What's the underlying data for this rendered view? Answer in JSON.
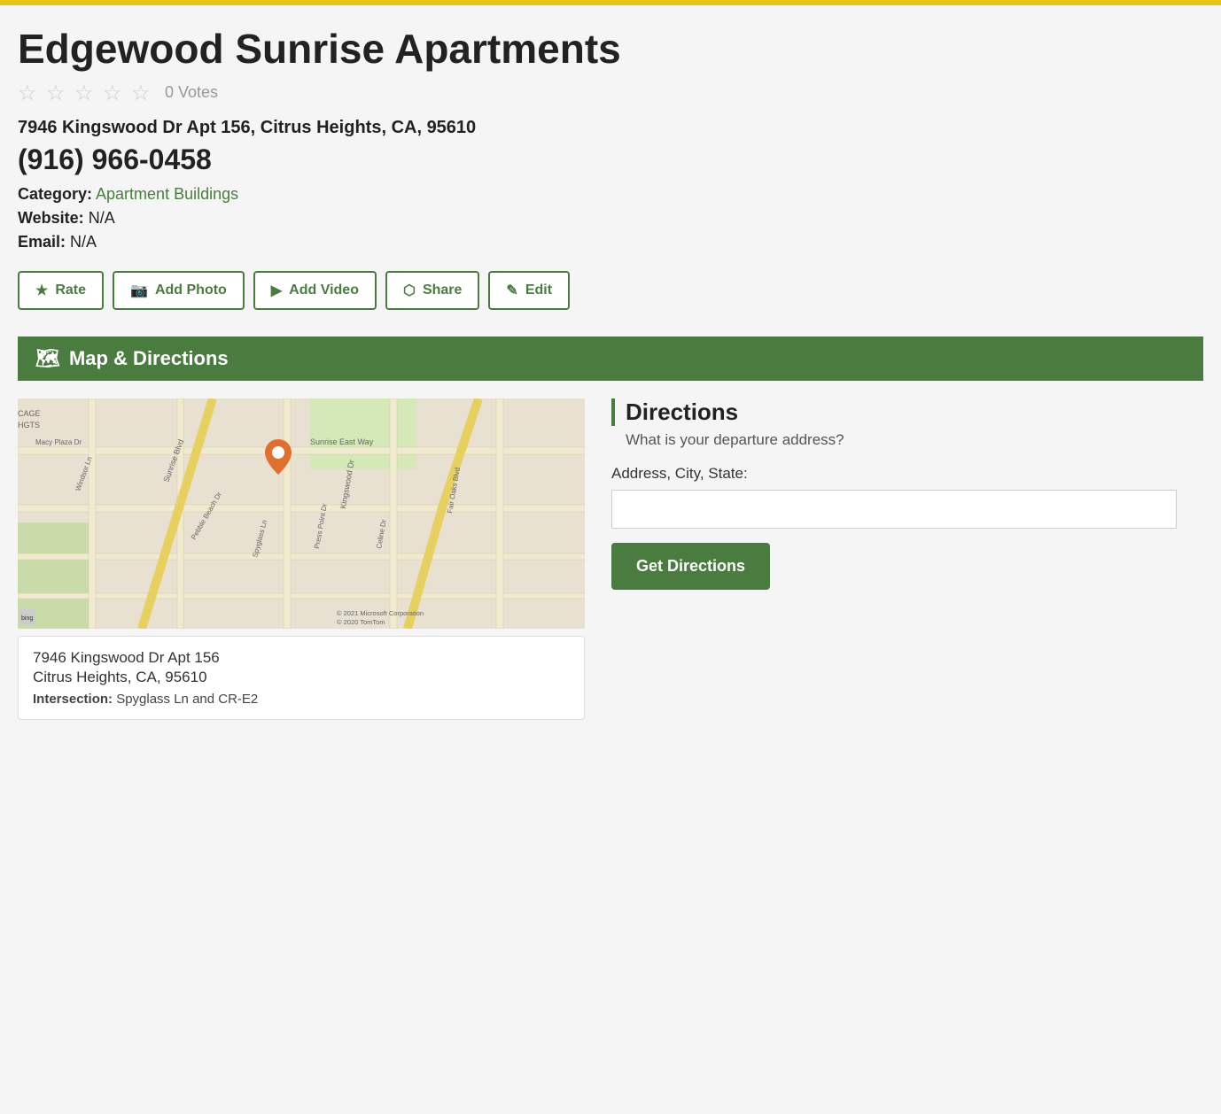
{
  "top_bar": {},
  "business": {
    "title": "Edgewood Sunrise Apartments",
    "rating": {
      "stars": 0,
      "max_stars": 5,
      "votes": "0 Votes"
    },
    "address": "7946 Kingswood Dr Apt 156, Citrus Heights, CA, 95610",
    "phone": "(916) 966-0458",
    "category_label": "Category:",
    "category_value": "Apartment Buildings",
    "website_label": "Website:",
    "website_value": "N/A",
    "email_label": "Email:",
    "email_value": "N/A"
  },
  "action_buttons": [
    {
      "id": "rate",
      "label": "Rate",
      "icon": "★"
    },
    {
      "id": "add-photo",
      "label": "Add Photo",
      "icon": "📷"
    },
    {
      "id": "add-video",
      "label": "Add Video",
      "icon": "▶"
    },
    {
      "id": "share",
      "label": "Share",
      "icon": "⬡"
    },
    {
      "id": "edit",
      "label": "Edit",
      "icon": "✎"
    }
  ],
  "map_section": {
    "header": "Map & Directions",
    "header_icon": "🗺",
    "address_line1": "7946 Kingswood Dr Apt 156",
    "address_line2": "Citrus Heights, CA, 95610",
    "intersection_label": "Intersection:",
    "intersection_value": "Spyglass Ln and CR-E2",
    "bing_label": "bing",
    "copyright": "© 2021 Microsoft Corporation  © 2020 TomTom"
  },
  "directions": {
    "title": "Directions",
    "subtitle": "What is your departure address?",
    "address_label": "Address, City, State:",
    "address_placeholder": "",
    "button_label": "Get Directions"
  }
}
